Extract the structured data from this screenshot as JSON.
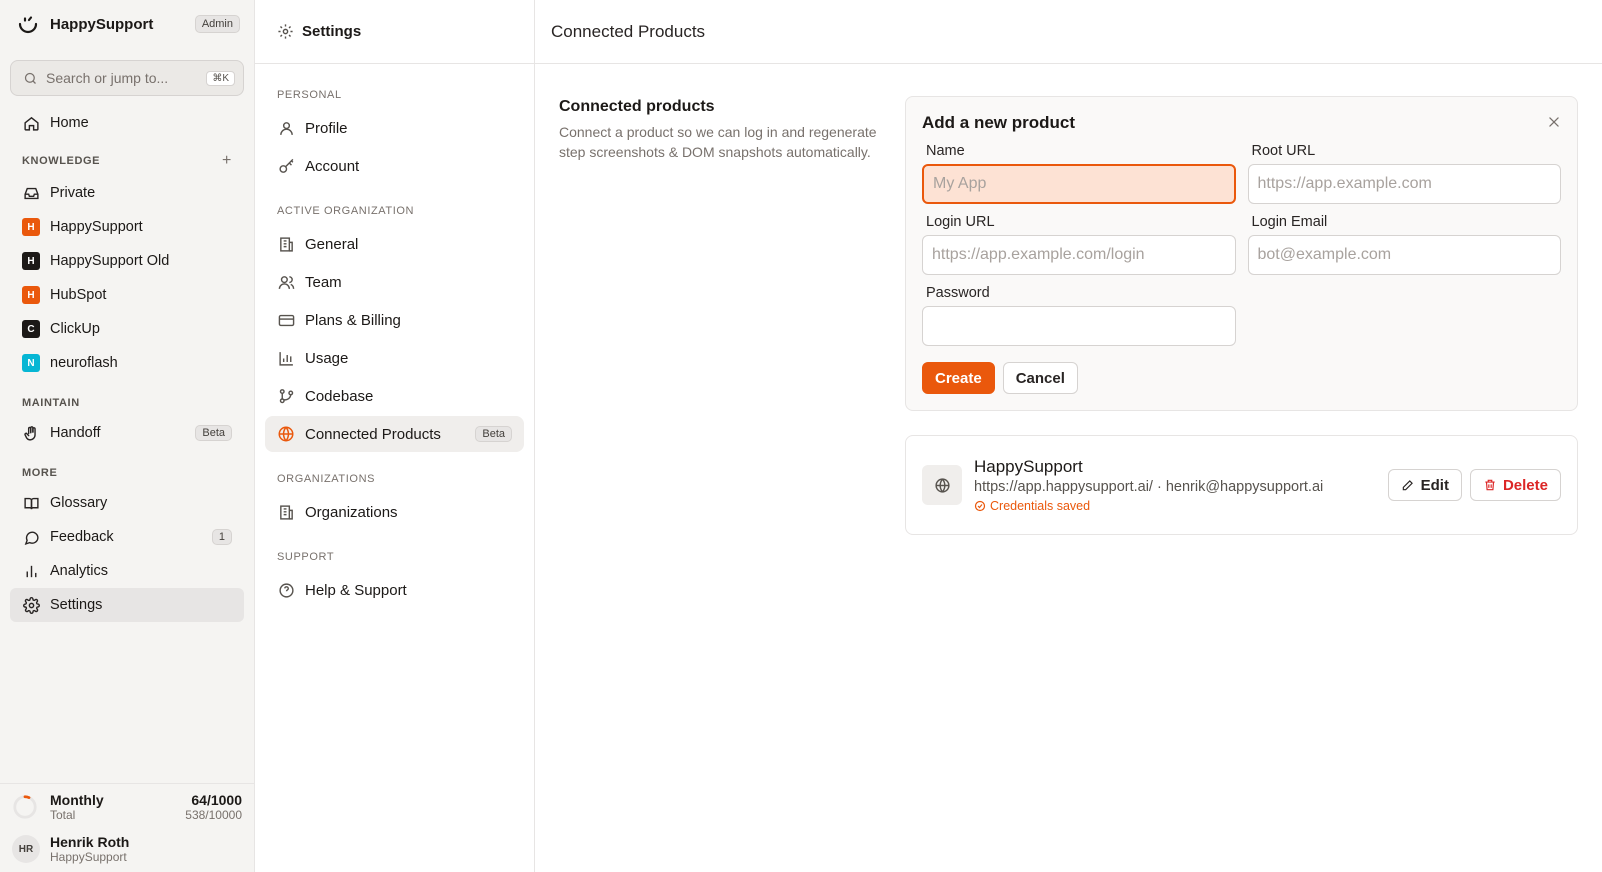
{
  "sidebar": {
    "brand": "HappySupport",
    "role_badge": "Admin",
    "search": {
      "placeholder": "Search or jump to...",
      "shortcut": "⌘K"
    },
    "home": "Home",
    "knowledge": {
      "heading": "KNOWLEDGE",
      "items": [
        {
          "label": "Private",
          "icon": "inbox-icon"
        },
        {
          "label": "HappySupport",
          "badge_letter": "H",
          "color": "#ea580c"
        },
        {
          "label": "HappySupport Old",
          "badge_letter": "H",
          "color": "#1c1917"
        },
        {
          "label": "HubSpot",
          "badge_letter": "H",
          "color": "#ea580c"
        },
        {
          "label": "ClickUp",
          "badge_letter": "C",
          "color": "#1c1917"
        },
        {
          "label": "neuroflash",
          "badge_letter": "N",
          "color": "#06b6d4"
        }
      ]
    },
    "maintain": {
      "heading": "MAINTAIN",
      "handoff": {
        "label": "Handoff",
        "badge": "Beta"
      }
    },
    "more": {
      "heading": "MORE",
      "glossary": "Glossary",
      "feedback": {
        "label": "Feedback",
        "count": "1"
      },
      "analytics": "Analytics",
      "settings": "Settings"
    },
    "usage": {
      "label": "Monthly",
      "sublabel": "Total",
      "monthly": "64/1000",
      "total": "538/10000",
      "monthly_fraction": 0.064
    },
    "user": {
      "initials": "HR",
      "name": "Henrik Roth",
      "org": "HappySupport"
    }
  },
  "settings_nav": {
    "title": "Settings",
    "sections": {
      "personal": "PERSONAL",
      "active_org": "ACTIVE ORGANIZATION",
      "organizations": "ORGANIZATIONS",
      "support": "SUPPORT"
    },
    "items": {
      "profile": "Profile",
      "account": "Account",
      "general": "General",
      "team": "Team",
      "billing": "Plans & Billing",
      "usage": "Usage",
      "codebase": "Codebase",
      "connected": "Connected Products",
      "connected_badge": "Beta",
      "organizations": "Organizations",
      "help": "Help & Support"
    }
  },
  "main": {
    "title": "Connected Products",
    "intro": {
      "heading": "Connected products",
      "description": "Connect a product so we can log in and regenerate step screenshots & DOM snapshots automatically."
    },
    "form": {
      "title": "Add a new product",
      "name": {
        "label": "Name",
        "placeholder": "My App",
        "value": ""
      },
      "root_url": {
        "label": "Root URL",
        "placeholder": "https://app.example.com",
        "value": ""
      },
      "login_url": {
        "label": "Login URL",
        "placeholder": "https://app.example.com/login",
        "value": ""
      },
      "login_email": {
        "label": "Login Email",
        "placeholder": "bot@example.com",
        "value": ""
      },
      "password": {
        "label": "Password",
        "placeholder": "",
        "value": ""
      },
      "create": "Create",
      "cancel": "Cancel"
    },
    "product": {
      "name": "HappySupport",
      "meta": "https://app.happysupport.ai/ · henrik@happysupport.ai",
      "status": "Credentials saved",
      "edit": "Edit",
      "delete": "Delete"
    }
  },
  "colors": {
    "accent": "#ea580c",
    "danger": "#dc2626"
  }
}
